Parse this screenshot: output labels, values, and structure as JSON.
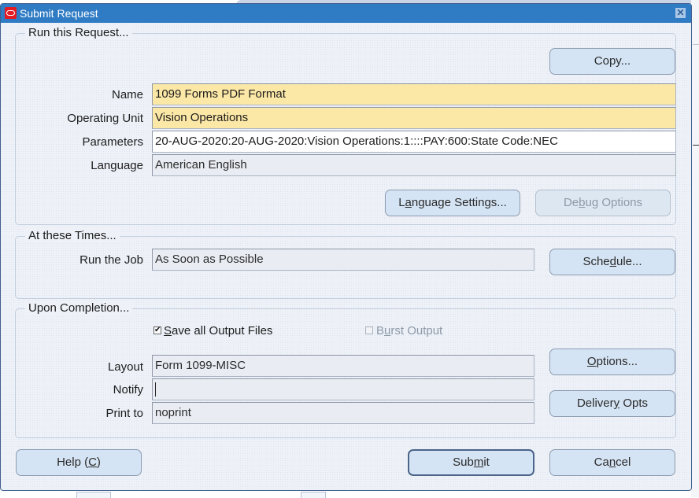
{
  "window": {
    "title": "Submit Request",
    "close_label": "✕"
  },
  "run_request": {
    "group_title": "Run this Request...",
    "copy_button": {
      "pre": "Copy",
      "accel": "",
      "post": "..."
    },
    "fields": {
      "name": {
        "label": "Name",
        "value": "1099 Forms PDF Format"
      },
      "operating_unit": {
        "label": "Operating Unit",
        "value": "Vision Operations"
      },
      "parameters": {
        "label": "Parameters",
        "value": "20-AUG-2020:20-AUG-2020:Vision Operations:1::::PAY:600:State Code:NEC"
      },
      "language": {
        "label": "Language",
        "value": "American English"
      }
    },
    "language_settings_button": {
      "pre": "L",
      "accel": "a",
      "post": "nguage Settings..."
    },
    "debug_options_button": {
      "pre": "De",
      "accel": "b",
      "post": "ug Options"
    }
  },
  "at_these_times": {
    "group_title": "At these Times...",
    "run_the_job": {
      "label": "Run the Job",
      "value": "As Soon as Possible"
    },
    "schedule_button": {
      "pre": "Sche",
      "accel": "d",
      "post": "ule..."
    }
  },
  "upon_completion": {
    "group_title": "Upon Completion...",
    "save_output": {
      "pre": "",
      "accel": "S",
      "post": "ave all Output Files",
      "checked": true
    },
    "burst_output": {
      "pre": "B",
      "accel": "u",
      "post": "rst Output",
      "checked": false,
      "enabled": false
    },
    "layout": {
      "label": "Layout",
      "value": "Form 1099-MISC"
    },
    "notify": {
      "label": "Notify",
      "value": ""
    },
    "print_to": {
      "label": "Print to",
      "value": "noprint"
    },
    "options_button": {
      "pre": "",
      "accel": "O",
      "post": "ptions..."
    },
    "delivery_opts_button": {
      "pre": "Deliver",
      "accel": "y",
      "post": " Opts"
    }
  },
  "footer": {
    "help_button": {
      "pre": "Help (",
      "accel": "C",
      "post": ")"
    },
    "submit_button": {
      "pre": "Sub",
      "accel": "m",
      "post": "it"
    },
    "cancel_button": {
      "pre": "Ca",
      "accel": "n",
      "post": "cel"
    }
  },
  "colors": {
    "titlebar": "#2f7bc4",
    "required_field": "#fbe7a6",
    "button": "#d5e4f4"
  }
}
